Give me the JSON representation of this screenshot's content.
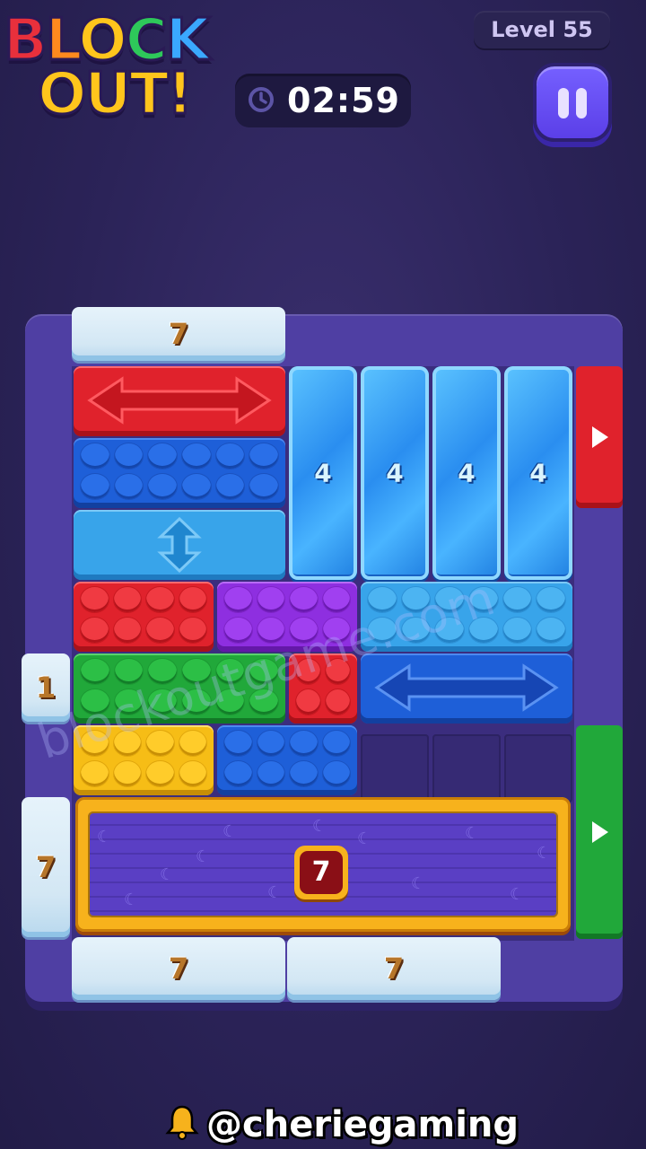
{
  "app": {
    "logo": {
      "line1": [
        "B",
        "L",
        "O",
        "C",
        "K"
      ],
      "line2": "OUT!"
    }
  },
  "header": {
    "level_label": "Level 55",
    "timer": "02:59",
    "timer_icon": "clock-icon",
    "pause_icon": "pause-icon"
  },
  "board": {
    "ice_blocks": [
      {
        "id": "ice-top",
        "counter": "7"
      },
      {
        "id": "ice-left-small",
        "counter": "1"
      },
      {
        "id": "ice-left-tall",
        "counter": "7"
      },
      {
        "id": "ice-bottom-left",
        "counter": "7"
      },
      {
        "id": "ice-bottom-right",
        "counter": "7"
      }
    ],
    "crystal_blocks": [
      {
        "counter": "4"
      },
      {
        "counter": "4"
      },
      {
        "counter": "4"
      },
      {
        "counter": "4"
      }
    ],
    "mystery_block": {
      "counter": "7"
    },
    "colors": {
      "red": "#e0222c",
      "blue": "#1e5fd8",
      "light_blue": "#38a4ea",
      "purple": "#8e2fe0",
      "green": "#21a83a",
      "yellow": "#f6bd16"
    },
    "exits": [
      {
        "color": "red",
        "icon": "arrow-right-icon"
      },
      {
        "color": "green",
        "icon": "arrow-right-icon"
      }
    ]
  },
  "overlay": {
    "watermark": "blockoutgame.com",
    "credit": "@cheriegaming",
    "credit_icon": "bell-icon"
  }
}
